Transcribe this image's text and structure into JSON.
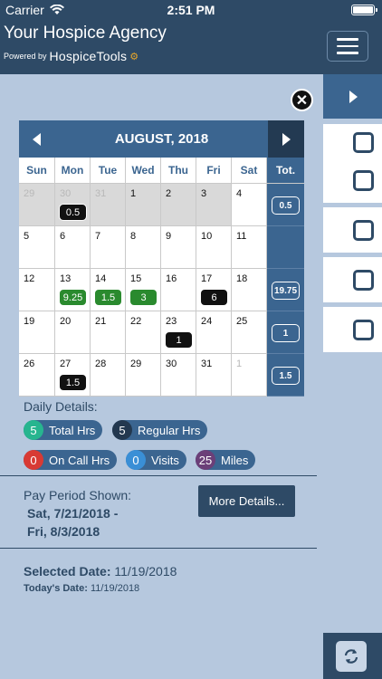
{
  "status_bar": {
    "carrier": "Carrier",
    "time": "2:51 PM"
  },
  "header": {
    "title": "Your Hospice Agency",
    "powered_by": "Powered by",
    "brand": "HospiceTools"
  },
  "calendar": {
    "month_title": "AUGUST, 2018",
    "weekdays": [
      "Sun",
      "Mon",
      "Tue",
      "Wed",
      "Thu",
      "Fri",
      "Sat"
    ],
    "total_label": "Tot.",
    "weeks": [
      {
        "total": "0.5",
        "days": [
          {
            "n": "29",
            "other": true,
            "grey": true,
            "badge": null,
            "badge_color": null
          },
          {
            "n": "30",
            "other": true,
            "grey": true,
            "badge": "0.5",
            "badge_color": "black"
          },
          {
            "n": "31",
            "other": true,
            "grey": true,
            "badge": null,
            "badge_color": null
          },
          {
            "n": "1",
            "other": false,
            "grey": true,
            "badge": null,
            "badge_color": null
          },
          {
            "n": "2",
            "other": false,
            "grey": true,
            "badge": null,
            "badge_color": null
          },
          {
            "n": "3",
            "other": false,
            "grey": true,
            "badge": null,
            "badge_color": null
          },
          {
            "n": "4",
            "other": false,
            "grey": false,
            "badge": null,
            "badge_color": null
          }
        ]
      },
      {
        "total": "",
        "days": [
          {
            "n": "5"
          },
          {
            "n": "6"
          },
          {
            "n": "7"
          },
          {
            "n": "8"
          },
          {
            "n": "9"
          },
          {
            "n": "10"
          },
          {
            "n": "11"
          }
        ]
      },
      {
        "total": "19.75",
        "days": [
          {
            "n": "12"
          },
          {
            "n": "13",
            "badge": "9.25",
            "badge_color": "green"
          },
          {
            "n": "14",
            "badge": "1.5",
            "badge_color": "green"
          },
          {
            "n": "15",
            "badge": "3",
            "badge_color": "green"
          },
          {
            "n": "16"
          },
          {
            "n": "17",
            "badge": "6",
            "badge_color": "black"
          },
          {
            "n": "18"
          }
        ]
      },
      {
        "total": "1",
        "days": [
          {
            "n": "19"
          },
          {
            "n": "20"
          },
          {
            "n": "21"
          },
          {
            "n": "22"
          },
          {
            "n": "23",
            "badge": "1",
            "badge_color": "black"
          },
          {
            "n": "24"
          },
          {
            "n": "25"
          }
        ]
      },
      {
        "total": "1.5",
        "days": [
          {
            "n": "26"
          },
          {
            "n": "27",
            "badge": "1.5",
            "badge_color": "black"
          },
          {
            "n": "28"
          },
          {
            "n": "29"
          },
          {
            "n": "30"
          },
          {
            "n": "31"
          },
          {
            "n": "1",
            "other": true
          }
        ]
      }
    ]
  },
  "daily_details": {
    "label": "Daily Details:",
    "stats": [
      {
        "key": "total-hrs",
        "value": "5",
        "label": "Total Hrs",
        "color": "#27b58f"
      },
      {
        "key": "regular-hrs",
        "value": "5",
        "label": "Regular Hrs",
        "color": "#23384f"
      },
      {
        "key": "on-call-hrs",
        "value": "0",
        "label": "On Call Hrs",
        "color": "#d83a34"
      },
      {
        "key": "visits",
        "value": "0",
        "label": "Visits",
        "color": "#3a8fd6"
      },
      {
        "key": "miles",
        "value": "25",
        "label": "Miles",
        "color": "#6b3f78"
      }
    ]
  },
  "pay_period": {
    "label": "Pay Period Shown:",
    "range_line1": "Sat, 7/21/2018 -",
    "range_line2": "Fri, 8/3/2018",
    "more_button": "More Details..."
  },
  "selected": {
    "selected_label": "Selected Date:",
    "selected_value": "11/19/2018",
    "today_label": "Today's Date:",
    "today_value": "11/19/2018"
  },
  "colors": {
    "header_bg": "#2e4a66",
    "calendar_header": "#3b6590",
    "panel_bg": "#b6c8de"
  }
}
